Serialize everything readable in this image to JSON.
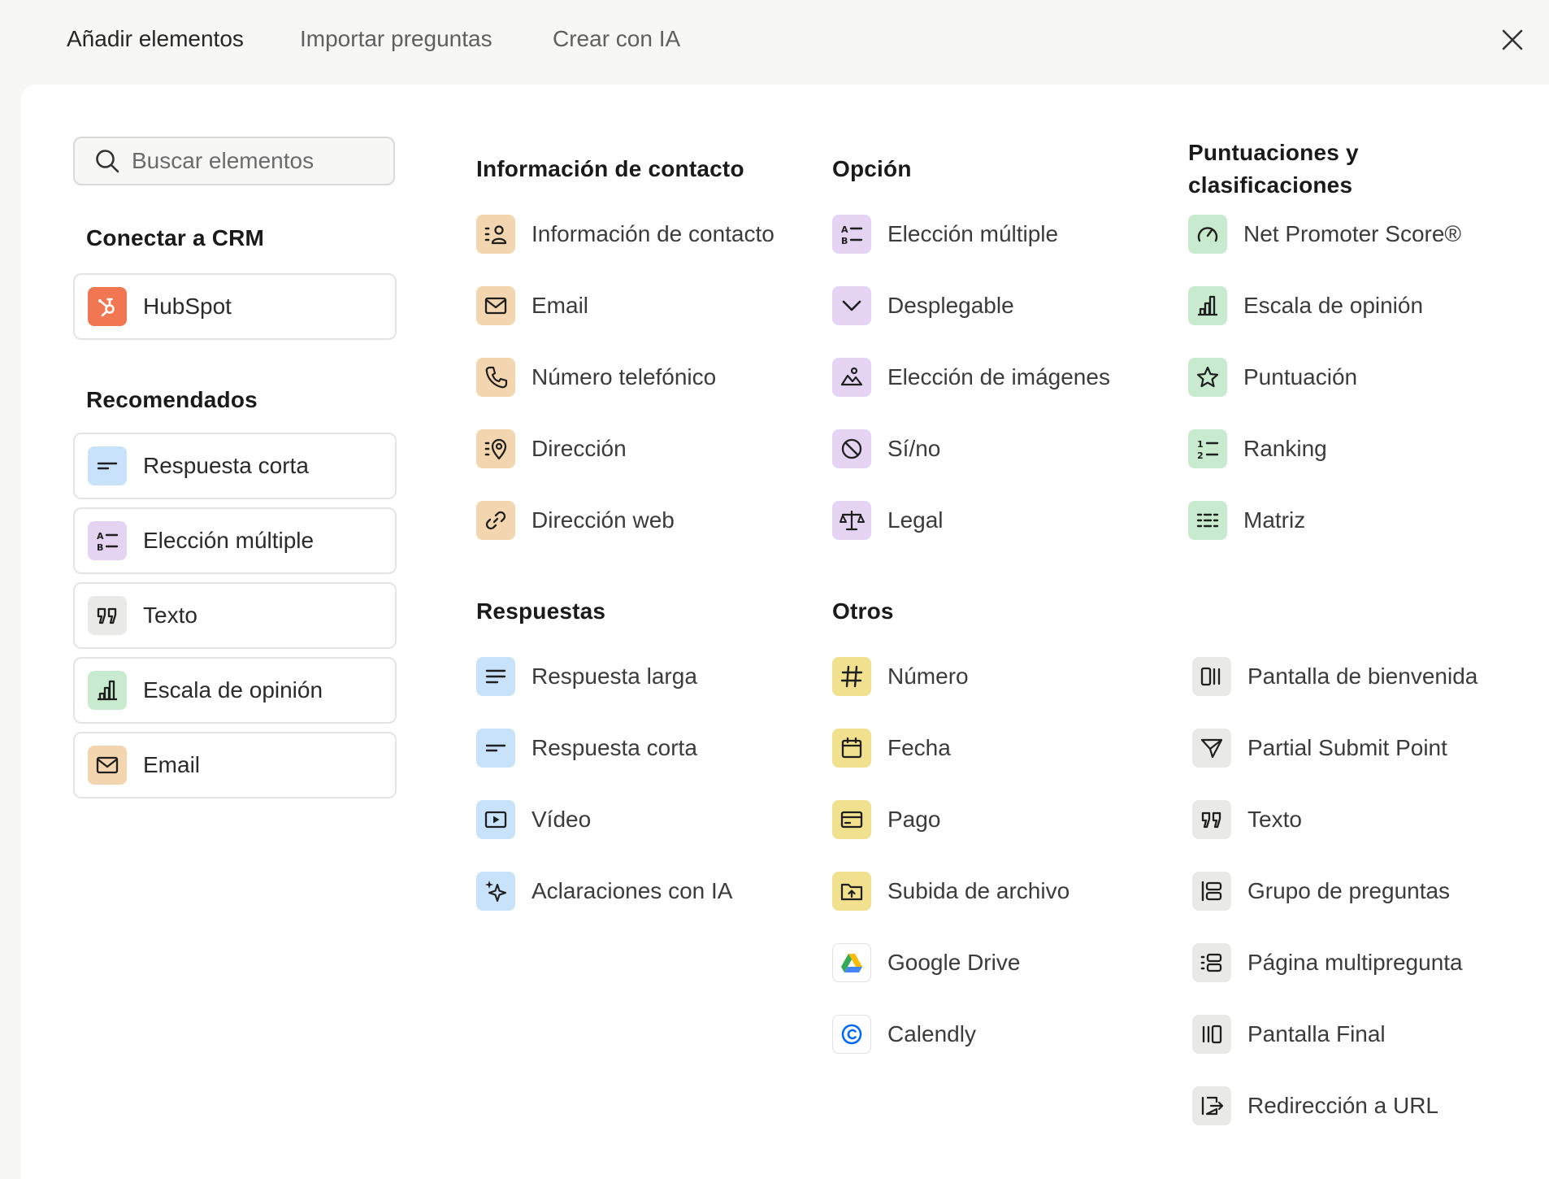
{
  "tabs": [
    "Añadir elementos",
    "Importar preguntas",
    "Crear con IA"
  ],
  "search": {
    "placeholder": "Buscar elementos"
  },
  "crm": {
    "heading": "Conectar a CRM",
    "item": {
      "label": "HubSpot",
      "icon": "hubspot-icon"
    }
  },
  "recommended": {
    "heading": "Recomendados",
    "items": [
      {
        "label": "Respuesta corta",
        "icon": "short-text-icon"
      },
      {
        "label": "Elección múltiple",
        "icon": "multiple-choice-icon"
      },
      {
        "label": "Texto",
        "icon": "quote-icon"
      },
      {
        "label": "Escala de opinión",
        "icon": "bar-chart-icon"
      },
      {
        "label": "Email",
        "icon": "envelope-icon"
      }
    ]
  },
  "contact": {
    "heading": "Información de contacto",
    "items": [
      {
        "label": "Información de contacto",
        "icon": "contact-card-icon"
      },
      {
        "label": "Email",
        "icon": "envelope-icon"
      },
      {
        "label": "Número telefónico",
        "icon": "phone-icon"
      },
      {
        "label": "Dirección",
        "icon": "location-pin-icon"
      },
      {
        "label": "Dirección web",
        "icon": "link-icon"
      }
    ]
  },
  "choice": {
    "heading": "Opción",
    "items": [
      {
        "label": "Elección múltiple",
        "icon": "multiple-choice-icon"
      },
      {
        "label": "Desplegable",
        "icon": "chevron-down-icon"
      },
      {
        "label": "Elección de imágenes",
        "icon": "image-icon"
      },
      {
        "label": "Sí/no",
        "icon": "yes-no-icon"
      },
      {
        "label": "Legal",
        "icon": "scales-icon"
      }
    ]
  },
  "ratings": {
    "heading_line1": "Puntuaciones y",
    "heading_line2": "clasificaciones",
    "items": [
      {
        "label": "Net Promoter Score®",
        "icon": "gauge-icon"
      },
      {
        "label": "Escala de opinión",
        "icon": "bar-chart-icon"
      },
      {
        "label": "Puntuación",
        "icon": "star-icon"
      },
      {
        "label": "Ranking",
        "icon": "ranked-list-icon"
      },
      {
        "label": "Matriz",
        "icon": "matrix-icon"
      }
    ]
  },
  "answers": {
    "heading": "Respuestas",
    "items": [
      {
        "label": "Respuesta larga",
        "icon": "long-text-icon"
      },
      {
        "label": "Respuesta corta",
        "icon": "short-text-icon"
      },
      {
        "label": "Vídeo",
        "icon": "video-icon"
      },
      {
        "label": "Aclaraciones con IA",
        "icon": "sparkle-icon"
      }
    ]
  },
  "others": {
    "heading": "Otros",
    "items": [
      {
        "label": "Número",
        "icon": "hash-icon"
      },
      {
        "label": "Fecha",
        "icon": "calendar-icon"
      },
      {
        "label": "Pago",
        "icon": "credit-card-icon"
      },
      {
        "label": "Subida de archivo",
        "icon": "folder-upload-icon"
      },
      {
        "label": "Google Drive",
        "icon": "google-drive-icon"
      },
      {
        "label": "Calendly",
        "icon": "calendly-icon"
      }
    ]
  },
  "screens": {
    "items": [
      {
        "label": "Pantalla de bienvenida",
        "icon": "welcome-screen-icon"
      },
      {
        "label": "Partial Submit Point",
        "icon": "send-icon"
      },
      {
        "label": "Texto",
        "icon": "quote-icon"
      },
      {
        "label": "Grupo de preguntas",
        "icon": "question-group-icon"
      },
      {
        "label": "Página multipregunta",
        "icon": "multi-question-icon"
      },
      {
        "label": "Pantalla Final",
        "icon": "end-screen-icon"
      },
      {
        "label": "Redirección a URL",
        "icon": "redirect-icon"
      }
    ]
  },
  "colors": {
    "contact": "#f3d6b0",
    "choice": "#e4d4f2",
    "ratings": "#c8ebcf",
    "answers": "#c9e2fb",
    "others": "#f1e08e",
    "screens": "#e9e9e7",
    "hubspot": "#f07751"
  }
}
